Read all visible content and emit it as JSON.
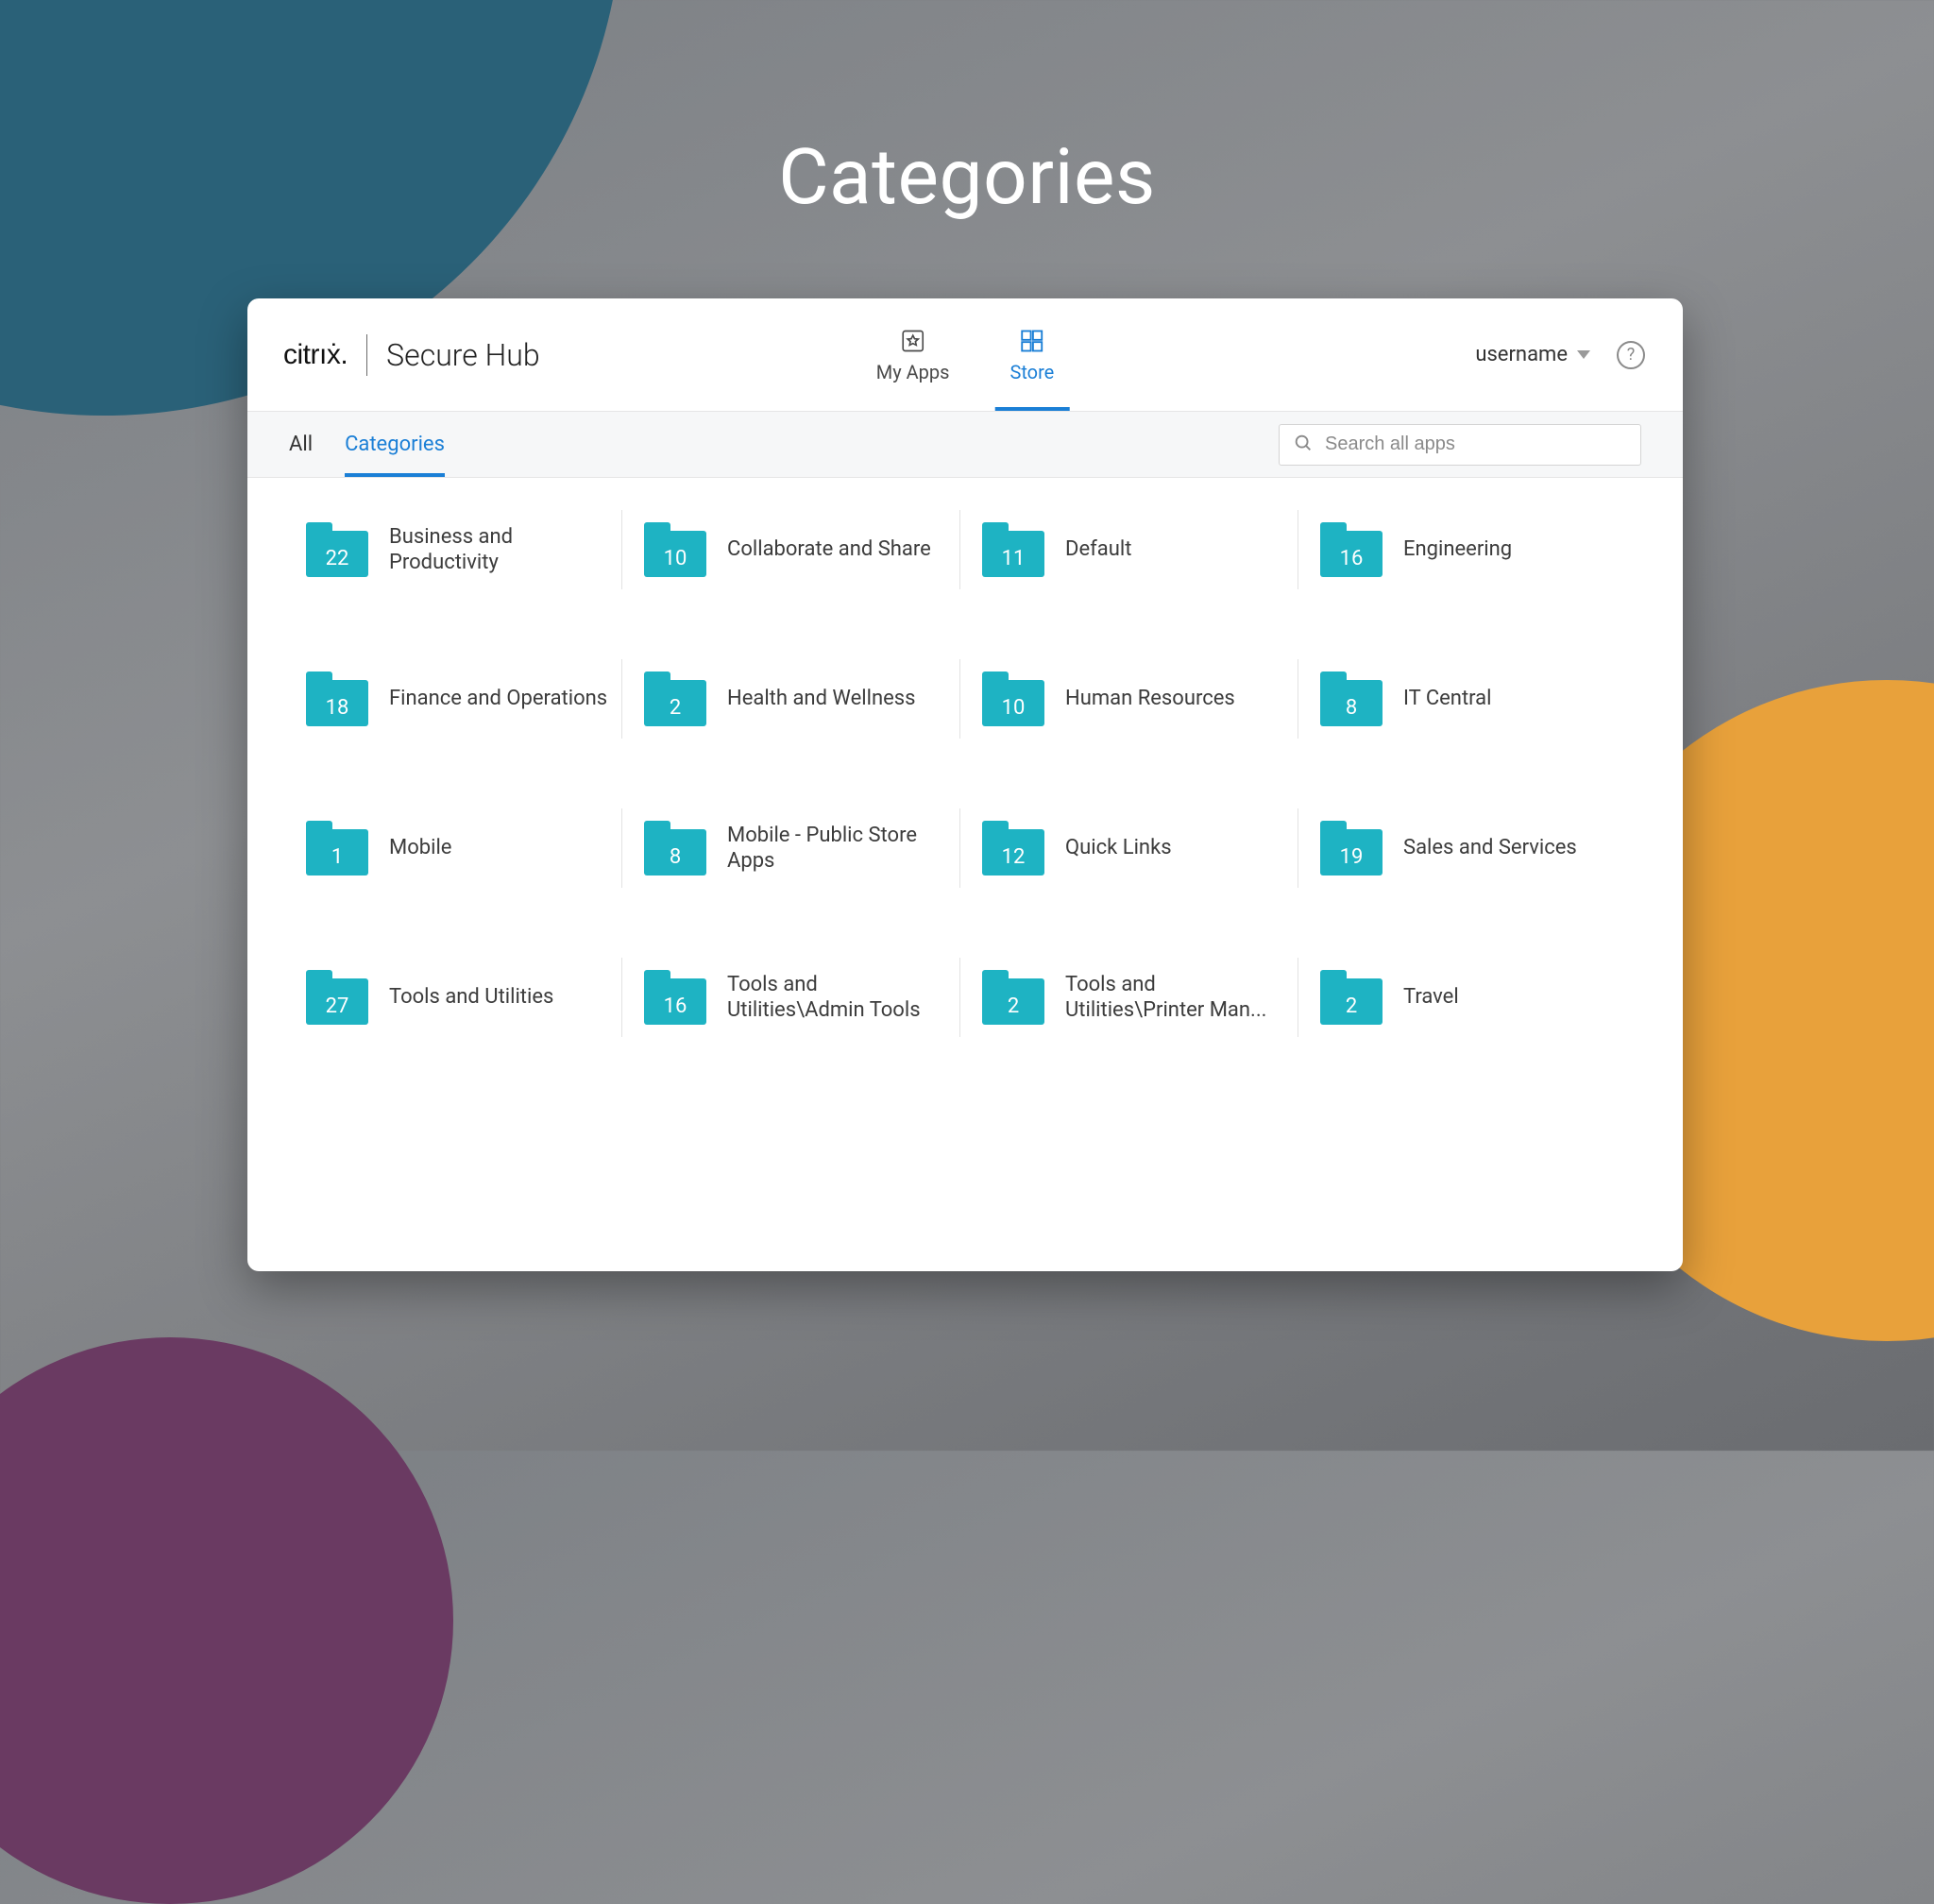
{
  "page": {
    "title": "Categories"
  },
  "brand": {
    "logo_text": "citrıẋ.",
    "product": "Secure Hub"
  },
  "nav": {
    "tabs": [
      {
        "id": "myapps",
        "label": "My Apps",
        "active": false
      },
      {
        "id": "store",
        "label": "Store",
        "active": true
      }
    ]
  },
  "user": {
    "name": "username"
  },
  "subtabs": [
    {
      "id": "all",
      "label": "All",
      "active": false
    },
    {
      "id": "categories",
      "label": "Categories",
      "active": true
    }
  ],
  "search": {
    "placeholder": "Search all apps"
  },
  "colors": {
    "accent": "#1b7fd6",
    "folder": "#1eb3c3"
  },
  "categories": [
    {
      "count": 22,
      "label": "Business and Productivity"
    },
    {
      "count": 10,
      "label": "Collaborate and Share"
    },
    {
      "count": 11,
      "label": "Default"
    },
    {
      "count": 16,
      "label": "Engineering"
    },
    {
      "count": 18,
      "label": "Finance and Operations"
    },
    {
      "count": 2,
      "label": "Health and Wellness"
    },
    {
      "count": 10,
      "label": "Human Resources"
    },
    {
      "count": 8,
      "label": "IT Central"
    },
    {
      "count": 1,
      "label": "Mobile"
    },
    {
      "count": 8,
      "label": "Mobile - Public Store Apps"
    },
    {
      "count": 12,
      "label": "Quick Links"
    },
    {
      "count": 19,
      "label": "Sales and Services"
    },
    {
      "count": 27,
      "label": "Tools and Utilities"
    },
    {
      "count": 16,
      "label": "Tools and Utilities\\Admin Tools"
    },
    {
      "count": 2,
      "label": "Tools and Utilities\\Printer Man..."
    },
    {
      "count": 2,
      "label": "Travel"
    }
  ]
}
